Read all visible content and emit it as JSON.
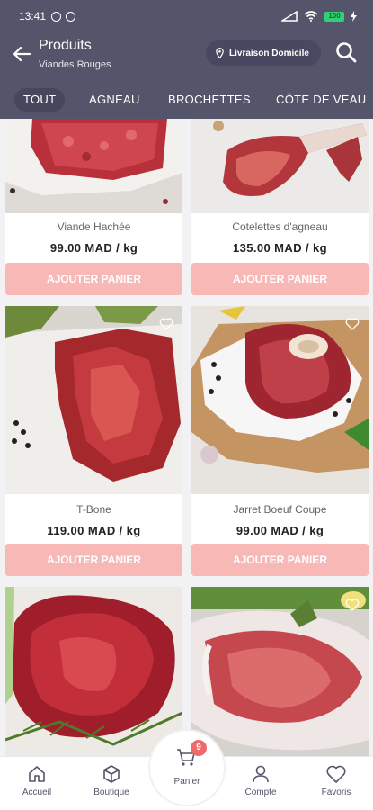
{
  "status": {
    "time": "13:41",
    "battery": "100"
  },
  "header": {
    "title": "Produits",
    "subtitle": "Viandes Rouges",
    "delivery_label": "Livraison Domicile"
  },
  "tabs": [
    "TOUT",
    "AGNEAU",
    "BROCHETTES",
    "CÔTE DE VEAU"
  ],
  "products": [
    {
      "name": "Viande Hachée",
      "price": "99.00 MAD / kg",
      "button": "AJOUTER PANIER"
    },
    {
      "name": "Cotelettes d'agneau",
      "price": "135.00 MAD / kg",
      "button": "AJOUTER PANIER"
    },
    {
      "name": "T-Bone",
      "price": "119.00 MAD / kg",
      "button": "AJOUTER PANIER"
    },
    {
      "name": "Jarret Boeuf Coupe",
      "price": "99.00 MAD / kg",
      "button": "AJOUTER PANIER"
    }
  ],
  "bottom_nav": {
    "accueil": "Accueil",
    "boutique": "Boutique",
    "panier": "Panier",
    "panier_count": "9",
    "compte": "Compte",
    "favoris": "Favoris"
  },
  "colors": {
    "header": "#54546a",
    "button": "#f7b8b6",
    "badge": "#ef6b6b"
  }
}
